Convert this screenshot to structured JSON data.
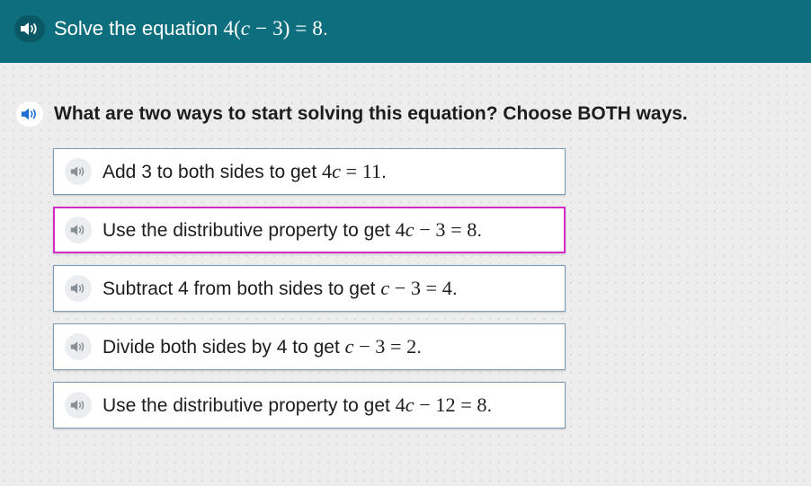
{
  "header": {
    "prompt_text": "Solve the equation ",
    "prompt_math": "4(c − 3) = 8",
    "prompt_end": "."
  },
  "question": {
    "text": "What are two ways to start solving this equation? Choose BOTH ways."
  },
  "choices": [
    {
      "text": "Add 3 to both sides to get ",
      "math": "4c = 11",
      "end": ".",
      "selected": false
    },
    {
      "text": "Use the distributive property to get ",
      "math": "4c − 3 = 8",
      "end": ".",
      "selected": true
    },
    {
      "text": "Subtract 4 from both sides to get ",
      "math": "c − 3 = 4",
      "end": ".",
      "selected": false
    },
    {
      "text": "Divide both sides by 4 to get ",
      "math": "c − 3 = 2",
      "end": ".",
      "selected": false
    },
    {
      "text": "Use the distributive property to get ",
      "math": "4c − 12 = 8",
      "end": ".",
      "selected": false
    }
  ],
  "icons": {
    "speaker": "speaker-icon"
  },
  "colors": {
    "header_bg": "#0d6f7e",
    "selected_border": "#d32bc4",
    "choice_border": "#7e9bb5",
    "speaker_blue": "#1c6fd1"
  }
}
